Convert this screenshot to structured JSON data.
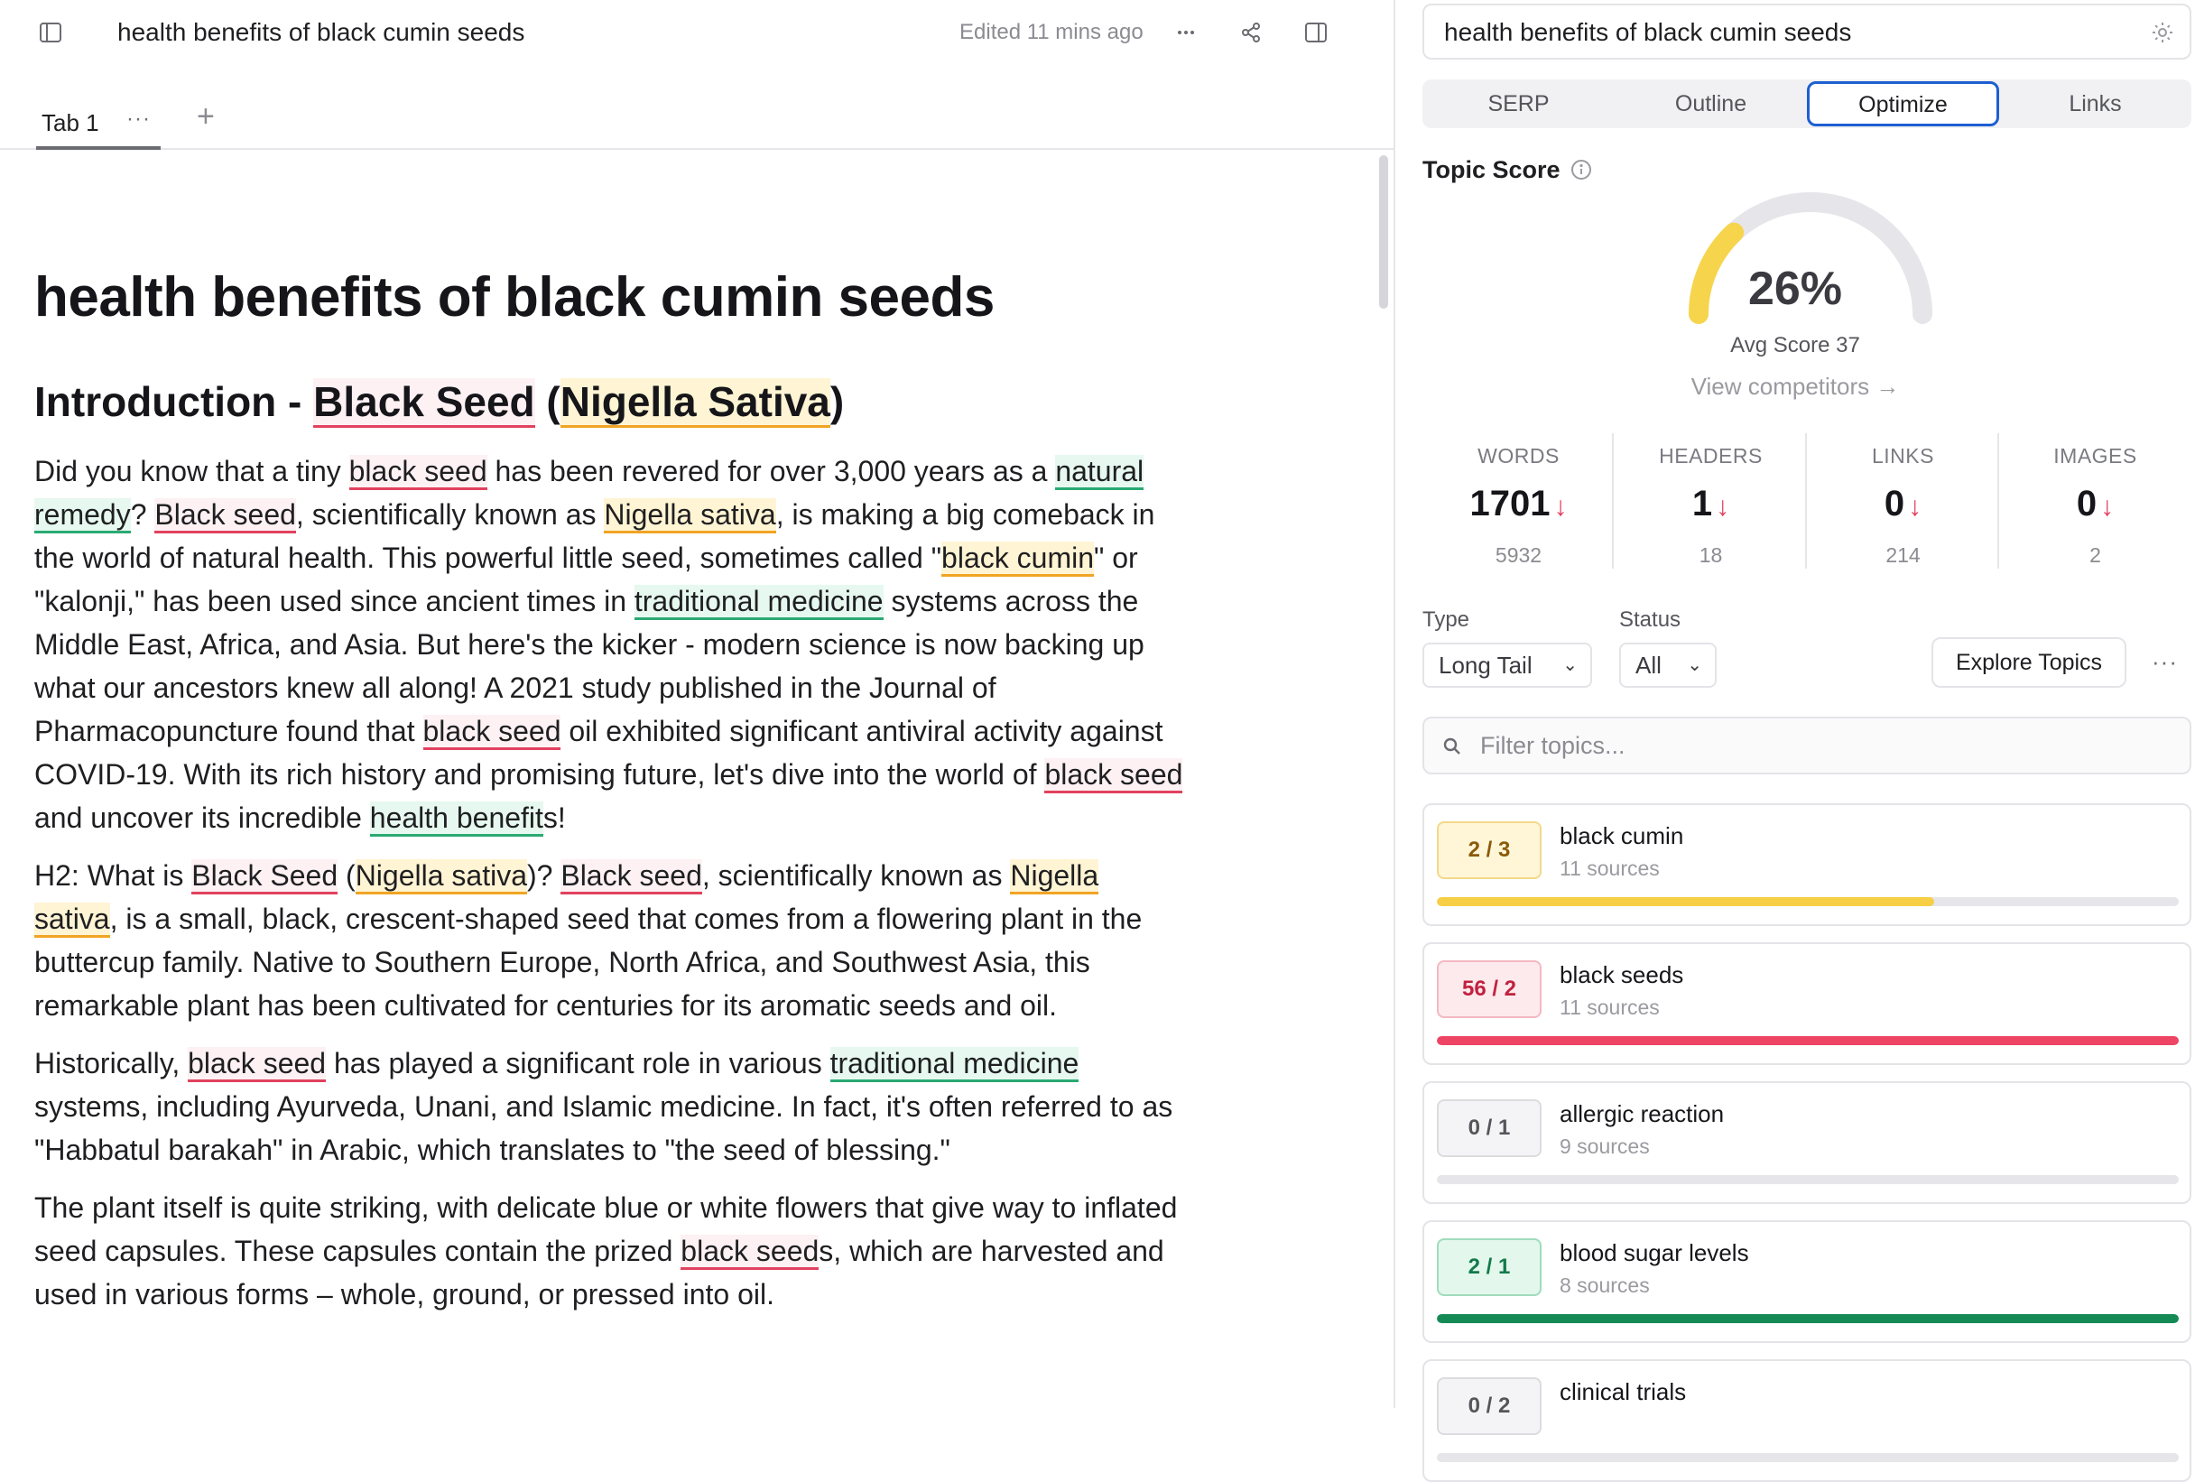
{
  "editor": {
    "doc_title": "health benefits of black cumin seeds",
    "edited_text": "Edited 11 mins ago",
    "tab_label": "Tab 1",
    "tab_more": "···",
    "tab_add": "+",
    "h1": "health benefits of black cumin seeds",
    "h2": {
      "prefix": "Introduction - ",
      "k1": "Black Seed",
      "mid": " (",
      "k2": "Nigella Sativa",
      "end": ")"
    },
    "p1": {
      "s1": "Did you know that a tiny ",
      "k1": "black seed",
      "s2": " has been revered for over 3,000 years as a ",
      "k2": "natural remedy",
      "s3": "? ",
      "k3": "Black seed",
      "s4": ", scientifically known as ",
      "k4": "Nigella sativa",
      "s5": ", is making a big comeback in the world of natural health. This powerful little seed, sometimes called \"",
      "k5": "black cumin",
      "s6": "\" or \"kalonji,\" has been used since ancient times in ",
      "k6": "traditional medicine",
      "s7": " systems across the Middle East, Africa, and Asia. But here's the kicker - modern science is now backing up what our ancestors knew all along! A 2021 study published in the Journal of Pharmacopuncture found that ",
      "k7": "black seed",
      "s8": " oil exhibited significant antiviral activity against COVID-19. With its rich history and promising future, let's dive into the world of ",
      "k8": "black seed",
      "s9": " and uncover its incredible ",
      "k9": "health benefit",
      "s10": "s!"
    },
    "p2": {
      "s1": "H2: What is ",
      "k1": "Black Seed",
      "s2": " (",
      "k2": "Nigella sativa",
      "s3": ")? ",
      "k3": "Black seed",
      "s4": ", scientifically known as ",
      "k4": "Nigella sativa",
      "s5": ", is a small, black, crescent-shaped seed that comes from a flowering plant in the buttercup family. Native to Southern Europe, North Africa, and Southwest Asia, this remarkable plant has been cultivated for centuries for its aromatic seeds and oil."
    },
    "p3": {
      "s1": "Historically, ",
      "k1": "black seed",
      "s2": " has played a significant role in various ",
      "k2": "traditional medicine",
      "s3": " systems, including Ayurveda, Unani, and Islamic medicine. In fact, it's often referred to as \"Habbatul barakah\" in Arabic, which translates to \"the seed of blessing.\""
    },
    "p4": {
      "s1": "The plant itself is quite striking, with delicate blue or white flowers that give way to inflated seed capsules. These capsules contain the prized ",
      "k1": "black seed",
      "s2": "s, which are harvested and used in various forms – whole, ground, or pressed into oil."
    }
  },
  "panel": {
    "query": "health benefits of black cumin seeds",
    "tabs": [
      "SERP",
      "Outline",
      "Optimize",
      "Links"
    ],
    "active_tab": "Optimize",
    "topic_score_label": "Topic Score",
    "score": 26,
    "score_text": "26%",
    "avg_text": "Avg Score 37",
    "view_competitors": "View competitors →",
    "stats": [
      {
        "label": "WORDS",
        "value": "1701",
        "sub": "5932"
      },
      {
        "label": "HEADERS",
        "value": "1",
        "sub": "18"
      },
      {
        "label": "LINKS",
        "value": "0",
        "sub": "214"
      },
      {
        "label": "IMAGES",
        "value": "0",
        "sub": "2"
      }
    ],
    "type_label": "Type",
    "type_value": "Long Tail",
    "status_label": "Status",
    "status_value": "All",
    "explore_label": "Explore Topics",
    "more": "···",
    "filter_placeholder": "Filter topics...",
    "topics": [
      {
        "name": "black cumin",
        "sources": "11 sources",
        "badge": "2 / 3",
        "progress": 0.67,
        "status": "partial"
      },
      {
        "name": "black seeds",
        "sources": "11 sources",
        "badge": "56 / 2",
        "progress": 1.0,
        "status": "over"
      },
      {
        "name": "allergic reaction",
        "sources": "9 sources",
        "badge": "0 / 1",
        "progress": 0.0,
        "status": "missing"
      },
      {
        "name": "blood sugar levels",
        "sources": "8 sources",
        "badge": "2 / 1",
        "progress": 1.0,
        "status": "complete"
      },
      {
        "name": "clinical trials",
        "sources": "",
        "badge": "0 / 2",
        "progress": 0.0,
        "status": "missing"
      }
    ],
    "colors": {
      "partial": {
        "bg": "#fff6d8",
        "border": "#f3d98a",
        "text": "#8a5a0a",
        "fill": "#f6cf45"
      },
      "over": {
        "bg": "#fdeaed",
        "border": "#f4b8c2",
        "text": "#c2213f",
        "fill": "#ef4565"
      },
      "missing": {
        "bg": "#f4f4f6",
        "border": "#dcdce0",
        "text": "#55555c",
        "fill": "#d6d6da"
      },
      "complete": {
        "bg": "#e3f7ec",
        "border": "#9fdcbd",
        "text": "#137a4a",
        "fill": "#158a55"
      },
      "accent": "#1e5fd1",
      "gauge": "#f6d54d"
    }
  }
}
